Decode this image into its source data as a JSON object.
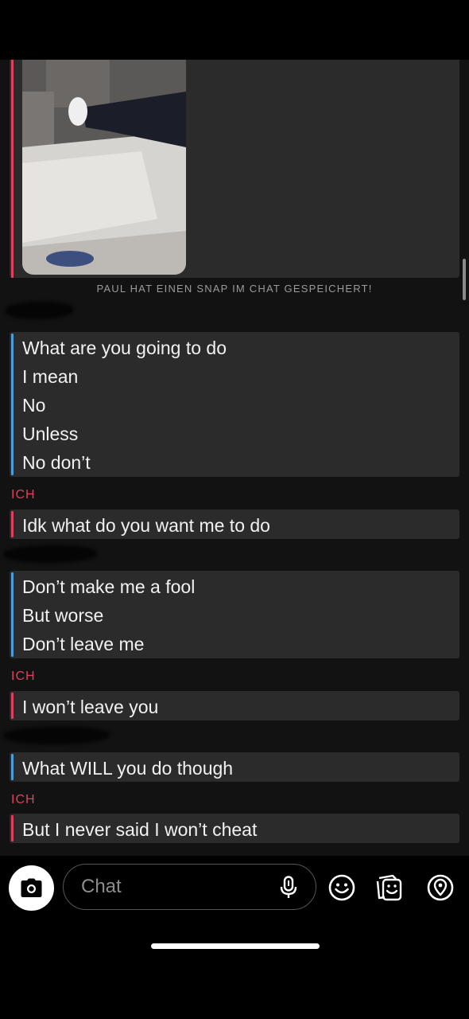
{
  "chat": {
    "saved_notice": "PAUL HAT EINEN SNAP IM CHAT GESPEICHERT!",
    "messages": [
      {
        "sender": "",
        "lines": [
          "What are you going to do",
          "I mean",
          "No",
          "Unless",
          "No don’t"
        ]
      },
      {
        "sender": "ICH",
        "lines": [
          "Idk what do you want me to do"
        ]
      },
      {
        "sender": "",
        "lines": [
          "Don’t make me a fool",
          "But worse",
          "Don’t leave me"
        ]
      },
      {
        "sender": "ICH",
        "lines": [
          "I won’t leave you"
        ]
      },
      {
        "sender": "",
        "lines": [
          "What WILL you do though"
        ]
      },
      {
        "sender": "ICH",
        "lines": [
          "But I never said I won’t cheat"
        ]
      }
    ]
  },
  "input": {
    "placeholder": "Chat",
    "value": ""
  },
  "icons": {
    "camera": "camera-icon",
    "mic": "microphone-icon",
    "emoji": "smiley-icon",
    "stickers": "sticker-icon",
    "snap_map": "map-pin-icon"
  },
  "colors": {
    "me_accent": "#e0405f",
    "friend_accent": "#4a9fd8",
    "bubble_bg": "#2b2b2b"
  }
}
